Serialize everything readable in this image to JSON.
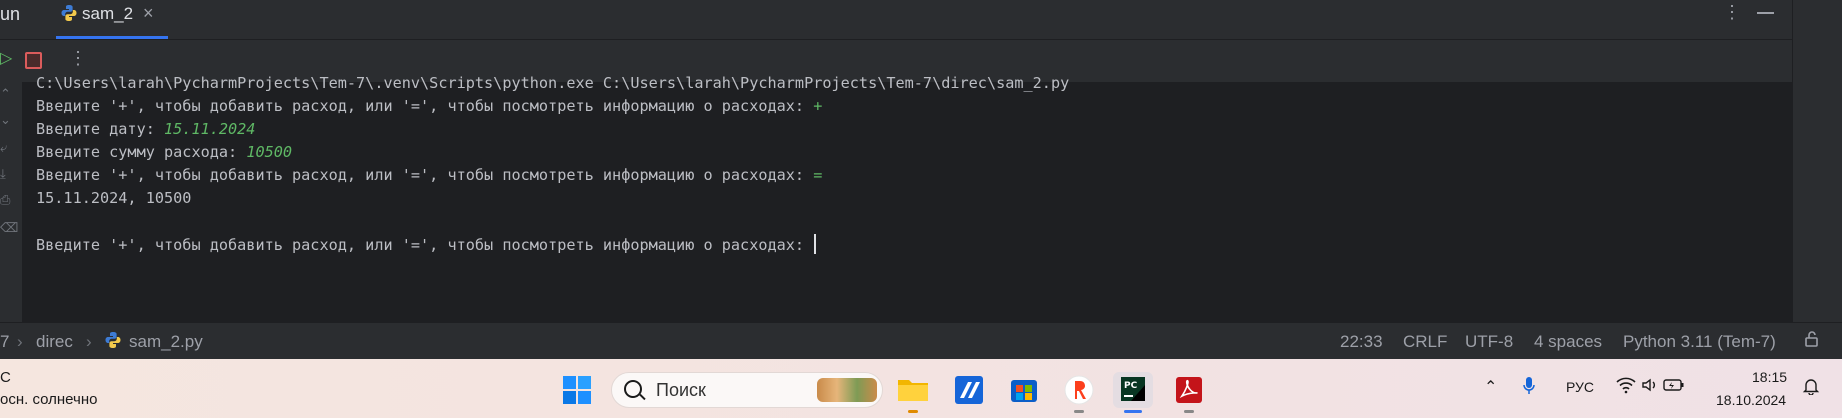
{
  "tool_window": {
    "title": "un",
    "tab": {
      "label": "sam_2"
    }
  },
  "console": {
    "lines": [
      {
        "text": "C:\\Users\\larah\\PycharmProjects\\Tem-7\\.venv\\Scripts\\python.exe C:\\Users\\larah\\PycharmProjects\\Tem-7\\direc\\sam_2.py",
        "input": ""
      },
      {
        "text": "Введите '+', чтобы добавить расход, или '=', чтобы посмотреть информацию о расходах: ",
        "input": "+"
      },
      {
        "text": "Введите дату: ",
        "input": "15.11.2024"
      },
      {
        "text": "Введите сумму расхода: ",
        "input": "10500"
      },
      {
        "text": "Введите '+', чтобы добавить расход, или '=', чтобы посмотреть информацию о расходах: ",
        "input": "="
      },
      {
        "text": "15.11.2024, 10500",
        "input": ""
      },
      {
        "text": "",
        "input": ""
      },
      {
        "text": "Введите '+', чтобы добавить расход, или '=', чтобы посмотреть информацию о расходах: ",
        "input": ""
      }
    ]
  },
  "statusbar": {
    "breadcrumb_root": "7",
    "breadcrumb_folder": "direc",
    "breadcrumb_file": "sam_2.py",
    "position": "22:33",
    "line_ending": "CRLF",
    "encoding": "UTF-8",
    "indent": "4 spaces",
    "interpreter": "Python 3.11 (Tem-7)"
  },
  "taskbar": {
    "weather_temp": "C",
    "weather_desc": "осн. солнечно",
    "search_placeholder": "Поиск",
    "language": "РУС",
    "time": "18:15",
    "date": "18.10.2024"
  },
  "colors": {
    "accent": "#3574f0",
    "input_text": "#5fb865",
    "console_bg": "#1e1f22",
    "panel_bg": "#2b2d30",
    "stop_red": "#db5c5c"
  }
}
